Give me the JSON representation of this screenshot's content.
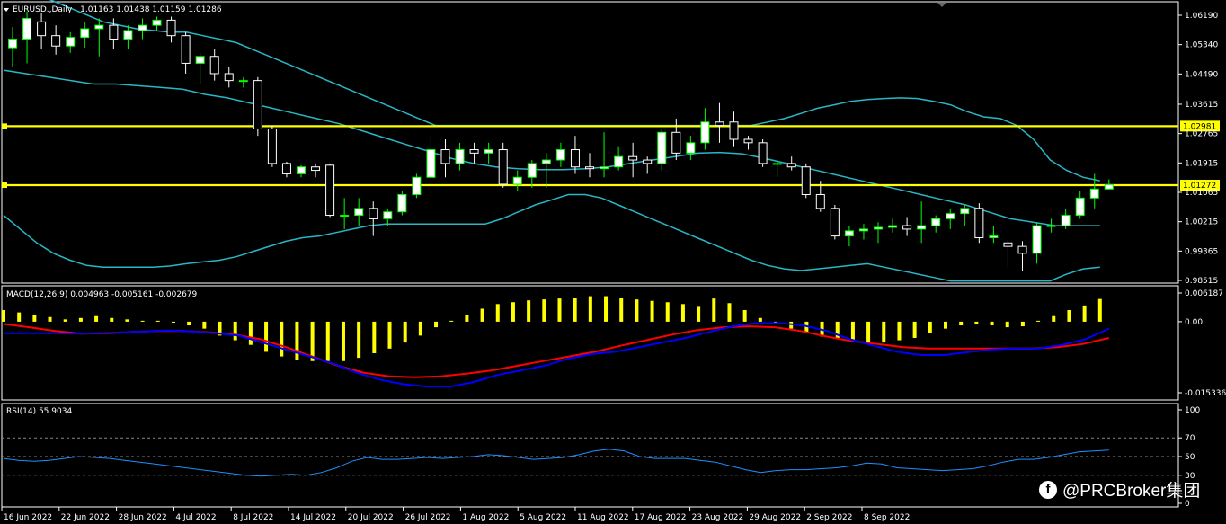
{
  "header": {
    "symbol_line": "EURUSD.,Daily",
    "ohlc": "1.01163 1.01438 1.01159 1.01286"
  },
  "indicators": {
    "macd_label": "MACD(12,26,9) 0.004963 -0.005161 -0.002679",
    "rsi_label": "RSI(14) 55.9034"
  },
  "watermark": {
    "text": "@PRCBroker集团",
    "icon": "facebook-icon"
  },
  "colors": {
    "background": "#000000",
    "bull_candle": "#ffffff",
    "bear_candle": "#000000",
    "wick_up": "#00ff00",
    "wick_down": "#ffffff",
    "bollinger": "#29b6c6",
    "level_line": "#ffff00",
    "macd_hist": "#ffff00",
    "macd_line": "#0000ff",
    "signal_line": "#ff0000",
    "rsi_line": "#1e90ff",
    "grid_panel": "#ffffff"
  },
  "chart_data": {
    "type": "candlestick",
    "price_axis": {
      "ticks": [
        "1.06190",
        "1.05340",
        "1.04490",
        "1.03615",
        "1.02765",
        "1.01915",
        "1.01065",
        "1.00215",
        "0.99365",
        "0.98515"
      ],
      "ylim": [
        0.98515,
        1.0636
      ]
    },
    "levels": [
      {
        "label": "1.02981",
        "value": 1.02981
      },
      {
        "label": "1.01272",
        "value": 1.01272
      }
    ],
    "date_labels": [
      "16 Jun 2022",
      "22 Jun 2022",
      "28 Jun 2022",
      "4 Jul 2022",
      "8 Jul 2022",
      "14 Jul 2022",
      "20 Jul 2022",
      "26 Jul 2022",
      "1 Aug 2022",
      "5 Aug 2022",
      "11 Aug 2022",
      "17 Aug 2022",
      "23 Aug 2022",
      "29 Aug 2022",
      "2 Sep 2022",
      "8 Sep 2022"
    ],
    "date_label_index": [
      0,
      4,
      8,
      12,
      16,
      20,
      24,
      28,
      32,
      36,
      40,
      44,
      48,
      52,
      56,
      60
    ],
    "candles": [
      [
        1.0525,
        1.0585,
        1.047,
        1.055
      ],
      [
        1.055,
        1.063,
        1.048,
        1.061
      ],
      [
        1.06,
        1.0625,
        1.052,
        1.056
      ],
      [
        1.056,
        1.059,
        1.0505,
        1.053
      ],
      [
        1.053,
        1.057,
        1.051,
        1.0555
      ],
      [
        1.0555,
        1.06,
        1.0525,
        1.058
      ],
      [
        1.058,
        1.061,
        1.05,
        1.059
      ],
      [
        1.059,
        1.061,
        1.052,
        1.055
      ],
      [
        1.055,
        1.059,
        1.052,
        1.0575
      ],
      [
        1.0575,
        1.061,
        1.055,
        1.059
      ],
      [
        1.059,
        1.0615,
        1.0575,
        1.0605
      ],
      [
        1.0605,
        1.0615,
        1.054,
        1.056
      ],
      [
        1.056,
        1.057,
        1.045,
        1.048
      ],
      [
        1.048,
        1.051,
        1.042,
        1.05
      ],
      [
        1.05,
        1.052,
        1.043,
        1.045
      ],
      [
        1.045,
        1.047,
        1.041,
        1.043
      ],
      [
        1.043,
        1.044,
        1.041,
        1.043
      ],
      [
        1.043,
        1.044,
        1.027,
        1.029
      ],
      [
        1.029,
        1.03,
        1.018,
        1.019
      ],
      [
        1.019,
        1.0195,
        1.015,
        1.016
      ],
      [
        1.016,
        1.0185,
        1.015,
        1.018
      ],
      [
        1.018,
        1.019,
        1.015,
        1.017
      ],
      [
        1.0185,
        1.019,
        1.0035,
        1.004
      ],
      [
        1.004,
        1.009,
        1.0,
        1.004
      ],
      [
        1.004,
        1.009,
        1.001,
        1.006
      ],
      [
        1.006,
        1.008,
        0.998,
        1.003
      ],
      [
        1.003,
        1.006,
        1.001,
        1.005
      ],
      [
        1.005,
        1.011,
        1.004,
        1.01
      ],
      [
        1.01,
        1.016,
        1.009,
        1.015
      ],
      [
        1.015,
        1.027,
        1.013,
        1.023
      ],
      [
        1.023,
        1.026,
        1.015,
        1.019
      ],
      [
        1.019,
        1.025,
        1.017,
        1.023
      ],
      [
        1.023,
        1.025,
        1.019,
        1.022
      ],
      [
        1.022,
        1.025,
        1.019,
        1.023
      ],
      [
        1.023,
        1.025,
        1.012,
        1.013
      ],
      [
        1.013,
        1.017,
        1.011,
        1.015
      ],
      [
        1.015,
        1.02,
        1.012,
        1.019
      ],
      [
        1.019,
        1.022,
        1.012,
        1.02
      ],
      [
        1.02,
        1.025,
        1.018,
        1.023
      ],
      [
        1.023,
        1.027,
        1.016,
        1.018
      ],
      [
        1.018,
        1.022,
        1.015,
        1.0175
      ],
      [
        1.0175,
        1.028,
        1.015,
        1.018
      ],
      [
        1.018,
        1.024,
        1.017,
        1.021
      ],
      [
        1.021,
        1.025,
        1.015,
        1.02
      ],
      [
        1.02,
        1.021,
        1.016,
        1.019
      ],
      [
        1.019,
        1.029,
        1.017,
        1.028
      ],
      [
        1.028,
        1.032,
        1.02,
        1.022
      ],
      [
        1.022,
        1.027,
        1.02,
        1.025
      ],
      [
        1.025,
        1.035,
        1.023,
        1.031
      ],
      [
        1.031,
        1.0365,
        1.025,
        1.03
      ],
      [
        1.031,
        1.034,
        1.024,
        1.026
      ],
      [
        1.026,
        1.027,
        1.023,
        1.025
      ],
      [
        1.025,
        1.026,
        1.018,
        1.019
      ],
      [
        1.019,
        1.02,
        1.015,
        1.019
      ],
      [
        1.019,
        1.021,
        1.017,
        1.018
      ],
      [
        1.018,
        1.019,
        1.009,
        1.01
      ],
      [
        1.01,
        1.014,
        1.005,
        1.006
      ],
      [
        1.006,
        1.007,
        0.997,
        0.998
      ],
      [
        0.998,
        1.001,
        0.995,
        0.9995
      ],
      [
        0.9995,
        1.0015,
        0.997,
        1.0
      ],
      [
        1.0,
        1.002,
        0.996,
        1.0005
      ],
      [
        1.0005,
        1.003,
        0.999,
        1.001
      ],
      [
        1.001,
        1.0035,
        0.998,
        1.0
      ],
      [
        1.0,
        1.008,
        0.996,
        1.001
      ],
      [
        1.001,
        1.004,
        0.999,
        1.003
      ],
      [
        1.003,
        1.006,
        1.0,
        1.0045
      ],
      [
        1.0045,
        1.007,
        1.001,
        1.006
      ],
      [
        1.006,
        1.0075,
        0.996,
        0.9975
      ],
      [
        0.9975,
        1.001,
        0.996,
        0.998
      ],
      [
        0.996,
        0.997,
        0.989,
        0.995
      ],
      [
        0.995,
        0.9965,
        0.988,
        0.993
      ],
      [
        0.993,
        1.002,
        0.99,
        1.001
      ],
      [
        1.001,
        1.003,
        0.999,
        1.001
      ],
      [
        1.001,
        1.006,
        1.0,
        1.004
      ],
      [
        1.004,
        1.011,
        1.003,
        1.009
      ],
      [
        1.009,
        1.016,
        1.006,
        1.0116
      ],
      [
        1.0116,
        1.0144,
        1.0116,
        1.0129
      ]
    ],
    "bollinger": {
      "upper": [
        1.07,
        1.07,
        1.068,
        1.066,
        1.064,
        1.062,
        1.06,
        1.059,
        1.058,
        1.0575,
        1.057,
        1.057,
        1.056,
        1.055,
        1.054,
        1.052,
        1.05,
        1.048,
        1.046,
        1.044,
        1.042,
        1.04,
        1.038,
        1.036,
        1.034,
        1.032,
        1.03,
        1.03,
        1.03,
        1.03,
        1.03,
        1.03,
        1.03,
        1.03,
        1.03,
        1.03,
        1.03,
        1.03,
        1.03,
        1.03,
        1.03,
        1.03,
        1.03,
        1.03,
        1.03,
        1.03,
        1.031,
        1.032,
        1.0335,
        1.035,
        1.036,
        1.037,
        1.0375,
        1.0378,
        1.038,
        1.0378,
        1.037,
        1.036,
        1.034,
        1.0325,
        1.032,
        1.03,
        1.026,
        1.02,
        1.017,
        1.015,
        1.014
      ],
      "middle": [
        1.046,
        1.045,
        1.044,
        1.043,
        1.042,
        1.042,
        1.0415,
        1.041,
        1.0405,
        1.039,
        1.038,
        1.0365,
        1.035,
        1.0335,
        1.032,
        1.0305,
        1.0285,
        1.0265,
        1.0245,
        1.0225,
        1.0205,
        1.019,
        1.018,
        1.0175,
        1.0172,
        1.0172,
        1.0175,
        1.018,
        1.019,
        1.02,
        1.021,
        1.022,
        1.0222,
        1.0218,
        1.0205,
        1.019,
        1.0175,
        1.016,
        1.0145,
        1.013,
        1.0115,
        1.01,
        1.0085,
        1.007,
        1.005,
        1.003,
        1.002,
        1.001,
        1.001,
        1.001
      ],
      "lower": [
        1.004,
        1.0,
        0.996,
        0.993,
        0.991,
        0.9895,
        0.989,
        0.989,
        0.989,
        0.989,
        0.9893,
        0.99,
        0.9905,
        0.991,
        0.992,
        0.9935,
        0.995,
        0.9965,
        0.9975,
        0.998,
        0.999,
        1.0,
        1.001,
        1.0015,
        1.0015,
        1.0015,
        1.0015,
        1.0015,
        1.0015,
        1.0015,
        1.003,
        1.005,
        1.007,
        1.0085,
        1.01,
        1.01,
        1.009,
        1.007,
        1.005,
        1.003,
        1.001,
        0.999,
        0.997,
        0.995,
        0.993,
        0.991,
        0.9895,
        0.9885,
        0.988,
        0.9885,
        0.989,
        0.9895,
        0.99,
        0.989,
        0.988,
        0.987,
        0.986,
        0.985,
        0.985,
        0.985,
        0.985,
        0.985,
        0.985,
        0.985,
        0.987,
        0.9885,
        0.989
      ]
    },
    "macd": {
      "axis_ticks": [
        "0.006187",
        "0.00",
        "-0.015336"
      ],
      "ylim": [
        -0.015336,
        0.006187
      ],
      "histogram": [
        0.0025,
        0.002,
        0.0015,
        0.001,
        0.0005,
        0.0008,
        0.0012,
        0.0008,
        0.0005,
        0.0002,
        0.0002,
        -0.0002,
        -0.0008,
        -0.0015,
        -0.003,
        -0.004,
        -0.005,
        -0.0065,
        -0.0075,
        -0.0082,
        -0.0085,
        -0.0085,
        -0.0085,
        -0.0078,
        -0.0068,
        -0.0058,
        -0.0045,
        -0.003,
        -0.0012,
        0.0002,
        0.0015,
        0.0028,
        0.0038,
        0.0042,
        0.0046,
        0.0048,
        0.005,
        0.0052,
        0.0055,
        0.0055,
        0.0052,
        0.0048,
        0.0045,
        0.0042,
        0.0038,
        0.0032,
        0.005,
        0.004,
        0.0025,
        0.0008,
        -0.0005,
        -0.0015,
        -0.0025,
        -0.0032,
        -0.0038,
        -0.0042,
        -0.0045,
        -0.0045,
        -0.004,
        -0.0035,
        -0.0025,
        -0.0015,
        -0.0008,
        -0.0005,
        -0.0008,
        -0.0012,
        -0.001,
        0.0002,
        0.0012,
        0.0025,
        0.0035,
        0.0049
      ],
      "macd_line": [
        -0.0025,
        -0.0025,
        -0.0025,
        -0.0026,
        -0.0025,
        -0.0023,
        -0.0021,
        -0.0019,
        -0.0021,
        -0.0025,
        -0.003,
        -0.0045,
        -0.006,
        -0.0075,
        -0.009,
        -0.011,
        -0.0125,
        -0.0135,
        -0.014,
        -0.014,
        -0.013,
        -0.0115,
        -0.0105,
        -0.0095,
        -0.008,
        -0.007,
        -0.0065,
        -0.0055,
        -0.0045,
        -0.0035,
        -0.0022,
        -0.001,
        -0.0003,
        -0.0003,
        -0.0008,
        -0.002,
        -0.0038,
        -0.0052,
        -0.0065,
        -0.0072,
        -0.0072,
        -0.0066,
        -0.006,
        -0.0058,
        -0.0058,
        -0.005,
        -0.0038,
        -0.0015
      ],
      "signal_line": [
        -0.0005,
        -0.0012,
        -0.002,
        -0.0026,
        -0.0025,
        -0.0022,
        -0.002,
        -0.002,
        -0.0023,
        -0.0028,
        -0.0038,
        -0.0055,
        -0.0075,
        -0.0095,
        -0.011,
        -0.0118,
        -0.012,
        -0.0118,
        -0.0112,
        -0.0105,
        -0.0095,
        -0.0085,
        -0.0075,
        -0.0065,
        -0.0052,
        -0.004,
        -0.0028,
        -0.0018,
        -0.0012,
        -0.001,
        -0.0012,
        -0.002,
        -0.0032,
        -0.0042,
        -0.0048,
        -0.0055,
        -0.0058,
        -0.0058,
        -0.0058,
        -0.0058,
        -0.0058,
        -0.0055,
        -0.0048,
        -0.0035
      ]
    },
    "rsi": {
      "axis_ticks": [
        "100",
        "70",
        "50",
        "30",
        "0"
      ],
      "ylim": [
        0,
        100
      ],
      "levels": [
        70,
        50,
        30
      ],
      "values": [
        48,
        46,
        45,
        46,
        48,
        50,
        49,
        48,
        46,
        44,
        42,
        40,
        38,
        36,
        34,
        32,
        30,
        29,
        30,
        31,
        30,
        33,
        38,
        45,
        49,
        47,
        47,
        48,
        49,
        48,
        49,
        50,
        52,
        51,
        49,
        47,
        48,
        49,
        52,
        56,
        58,
        56,
        50,
        48,
        48,
        48,
        46,
        44,
        40,
        36,
        33,
        35,
        36,
        36,
        37,
        38,
        40,
        43,
        42,
        38,
        37,
        36,
        35,
        36,
        37,
        40,
        44,
        47,
        47,
        49,
        52,
        55,
        56,
        56.9
      ]
    }
  }
}
